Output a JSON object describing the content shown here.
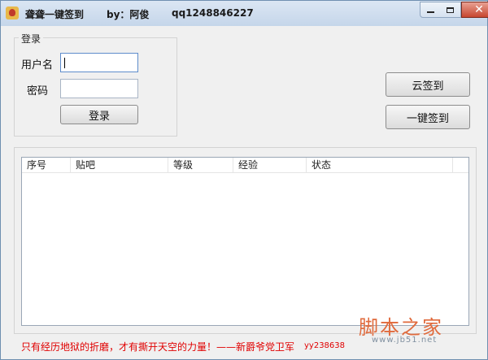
{
  "window": {
    "title": "聋聋一键签到",
    "author": "by：阿俊",
    "qq": "qq1248846227",
    "close_glyph": "✕"
  },
  "login": {
    "legend": "登录",
    "username_label": "用户名",
    "username_value": "",
    "password_label": "密码",
    "password_value": "",
    "login_button": "登录"
  },
  "actions": {
    "cloud_sign": "云签到",
    "one_key_sign": "一键签到"
  },
  "table": {
    "columns": [
      "序号",
      "贴吧",
      "等级",
      "经验",
      "状态"
    ],
    "rows": []
  },
  "footer": {
    "slogan": "只有经历地狱的折磨，才有撕开天空的力量！——新爵爷党卫军",
    "qq": "yy238638"
  },
  "watermark": {
    "brand": "脚本之家",
    "url": "www.jb51.net"
  }
}
